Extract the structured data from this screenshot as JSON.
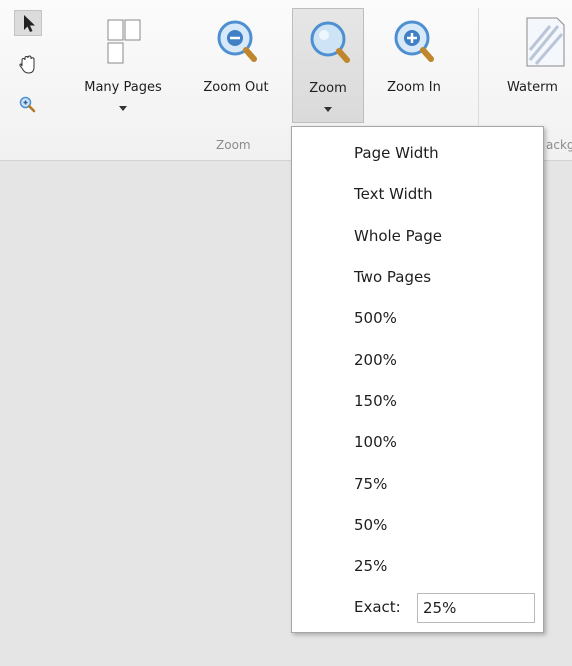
{
  "ribbon": {
    "buttons": {
      "many_pages": "Many Pages",
      "zoom_out": "Zoom Out",
      "zoom": "Zoom",
      "zoom_in": "Zoom In",
      "watermark": "Waterm"
    },
    "group_zoom_label": "Zoom",
    "group_background_label": "ackg"
  },
  "tools": [
    "pointer-icon",
    "hand-icon",
    "zoom-tool-icon"
  ],
  "zoom_menu": {
    "items": [
      "Page Width",
      "Text Width",
      "Whole Page",
      "Two Pages",
      "500%",
      "200%",
      "150%",
      "100%",
      "75%",
      "50%",
      "25%"
    ],
    "exact_label": "Exact:",
    "exact_value": "25%"
  },
  "colors": {
    "ribbon_bg": "#f4f4f4",
    "workspace_bg": "#e5e5e5",
    "menu_bg": "#ffffff",
    "zoom_icon_blue": "#4d8fd1"
  }
}
